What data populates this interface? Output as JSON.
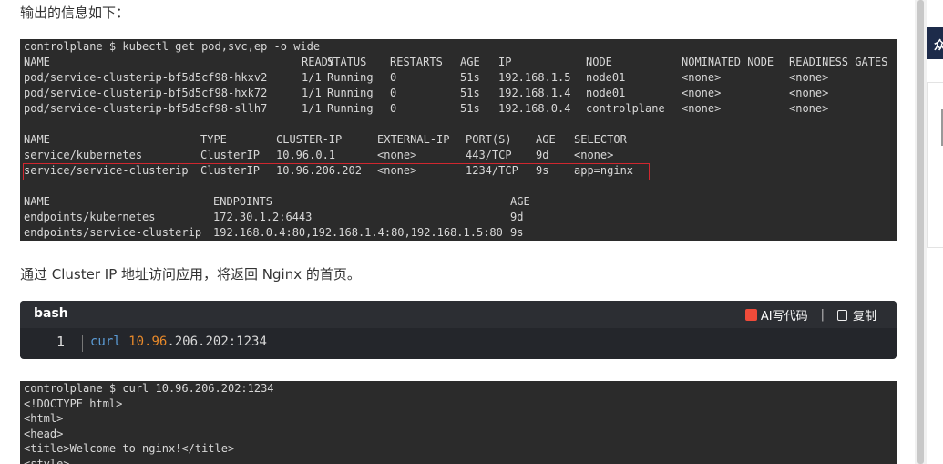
{
  "intro_text": "输出的信息如下：",
  "mid_text": "通过 Cluster IP 地址访问应用，将返回 Nginx 的首页。",
  "terminal1": {
    "command": "controlplane $ kubectl get pod,svc,ep -o wide",
    "pods": {
      "headers": [
        "NAME",
        "READY",
        "STATUS",
        "RESTARTS",
        "AGE",
        "IP",
        "NODE",
        "NOMINATED NODE",
        "READINESS GATES"
      ],
      "rows": [
        [
          "pod/service-clusterip-bf5d5cf98-hkxv2",
          "1/1",
          "Running",
          "0",
          "51s",
          "192.168.1.5",
          "node01",
          "<none>",
          "<none>"
        ],
        [
          "pod/service-clusterip-bf5d5cf98-hxk72",
          "1/1",
          "Running",
          "0",
          "51s",
          "192.168.1.4",
          "node01",
          "<none>",
          "<none>"
        ],
        [
          "pod/service-clusterip-bf5d5cf98-sllh7",
          "1/1",
          "Running",
          "0",
          "51s",
          "192.168.0.4",
          "controlplane",
          "<none>",
          "<none>"
        ]
      ]
    },
    "services": {
      "headers": [
        "NAME",
        "TYPE",
        "CLUSTER-IP",
        "EXTERNAL-IP",
        "PORT(S)",
        "AGE",
        "SELECTOR"
      ],
      "rows": [
        [
          "service/kubernetes",
          "ClusterIP",
          "10.96.0.1",
          "<none>",
          "443/TCP",
          "9d",
          "<none>"
        ],
        [
          "service/service-clusterip",
          "ClusterIP",
          "10.96.206.202",
          "<none>",
          "1234/TCP",
          "9s",
          "app=nginx"
        ]
      ]
    },
    "endpoints": {
      "headers": [
        "NAME",
        "ENDPOINTS",
        "AGE"
      ],
      "rows": [
        [
          "endpoints/kubernetes",
          "172.30.1.2:6443",
          "9d"
        ],
        [
          "endpoints/service-clusterip",
          "192.168.0.4:80,192.168.1.4:80,192.168.1.5:80",
          "9s"
        ]
      ]
    }
  },
  "codeblock": {
    "lang": "bash",
    "ai_label": "AI写代码",
    "copy_label": "复制",
    "line_number": "1",
    "code_cmd": "curl",
    "code_num": "10.96",
    "code_rest": ".206.202:1234"
  },
  "terminal2": {
    "lines": [
      "controlplane $ curl 10.96.206.202:1234",
      "<!DOCTYPE html>",
      "<html>",
      "<head>",
      "<title>Welcome to nginx!</title>",
      "<style>"
    ]
  },
  "side_tab_char": "众",
  "colors": {
    "terminal_bg": "#2b2b2b",
    "highlight_border": "#d0272f",
    "code_cmd": "#5b9bd5",
    "code_num": "#e8892a"
  }
}
